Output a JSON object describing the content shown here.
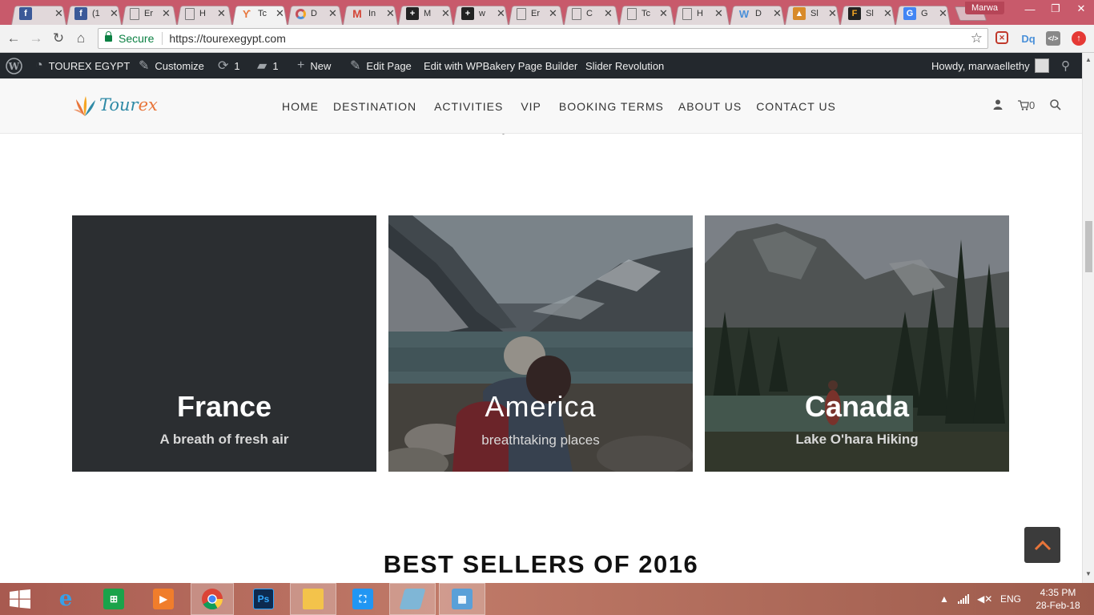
{
  "browser": {
    "tabs": [
      {
        "label": "",
        "favicon": "F",
        "color": "#3b5998",
        "active": false
      },
      {
        "label": "(1",
        "favicon": "F",
        "color": "#3b5998",
        "active": false
      },
      {
        "label": "Er",
        "favicon": "doc",
        "color": "#888888",
        "active": false
      },
      {
        "label": "H",
        "favicon": "doc",
        "color": "#888888",
        "active": false
      },
      {
        "label": "Tc",
        "favicon": "tourex",
        "color": "#e8753a",
        "active": true
      },
      {
        "label": "D",
        "favicon": "O",
        "color": "#c44d58",
        "active": false
      },
      {
        "label": "In",
        "favicon": "M",
        "color": "#d44638",
        "active": false
      },
      {
        "label": "M",
        "favicon": "+",
        "color": "#222222",
        "active": false
      },
      {
        "label": "w",
        "favicon": "+",
        "color": "#222222",
        "active": false
      },
      {
        "label": "Er",
        "favicon": "doc",
        "color": "#888888",
        "active": false
      },
      {
        "label": "C",
        "favicon": "doc",
        "color": "#888888",
        "active": false
      },
      {
        "label": "Tc",
        "favicon": "doc",
        "color": "#888888",
        "active": false
      },
      {
        "label": "H",
        "favicon": "doc",
        "color": "#888888",
        "active": false
      },
      {
        "label": "D",
        "favicon": "W",
        "color": "#4a90d9",
        "active": false
      },
      {
        "label": "Sl",
        "favicon": "camel",
        "color": "#d88a2a",
        "active": false
      },
      {
        "label": "Sl",
        "favicon": "F",
        "color": "#222222",
        "active": false
      },
      {
        "label": "G",
        "favicon": "G",
        "color": "#4285f4",
        "active": false
      }
    ],
    "user": "Marwa",
    "secure_label": "Secure",
    "url": "https://tourexegypt.com"
  },
  "wpbar": {
    "site_name": "TOUREX EGYPT",
    "customize": "Customize",
    "updates_count": "1",
    "comments_count": "1",
    "new_label": "New",
    "edit_page": "Edit Page",
    "wpbakery": "Edit with WPBakery Page Builder",
    "slider": "Slider Revolution",
    "howdy": "Howdy, marwaellethy"
  },
  "site": {
    "logo_prefix": "Tour",
    "logo_suffix": "ex",
    "nav": [
      "HOME",
      "DESTINATION",
      "ACTIVITIES",
      "VIP",
      "BOOKING TERMS",
      "ABOUT US",
      "CONTACT US"
    ],
    "cart_count": "0"
  },
  "destinations": [
    {
      "title": "France",
      "subtitle": "A breath of fresh air"
    },
    {
      "title": "America",
      "subtitle": "breathtaking places"
    },
    {
      "title": "Canada",
      "subtitle": "Lake O'hara Hiking"
    }
  ],
  "section_title": "BEST SELLERS OF 2016",
  "taskbar": {
    "lang": "ENG",
    "time": "4:35 PM",
    "date": "28-Feb-18"
  },
  "colors": {
    "tabstrip": "#c85a6b",
    "wpbar": "#23282d",
    "card_dark": "#2b2e31",
    "logo_blue": "#2f8aa6",
    "logo_orange": "#e8753a",
    "totop_arrow": "#e8753a"
  }
}
